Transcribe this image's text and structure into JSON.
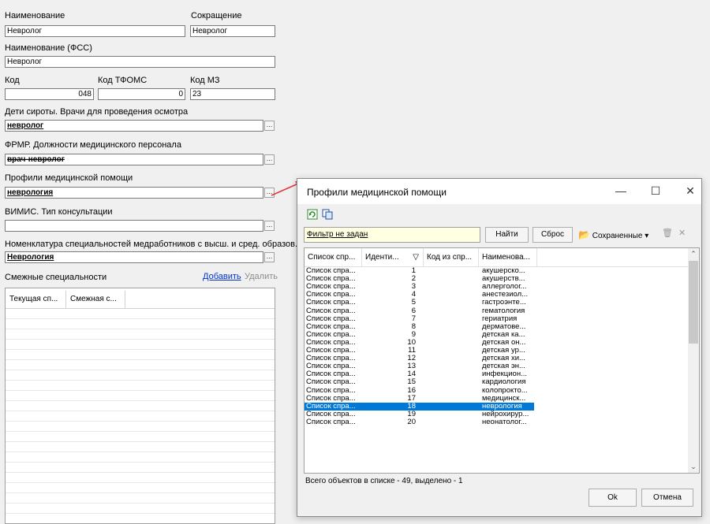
{
  "form": {
    "name_label": "Наименование",
    "name_value": "Невролог",
    "short_label": "Сокращение",
    "short_value": "Невролог",
    "fss_label": "Наименование (ФСС)",
    "fss_value": "Невролог",
    "code_label": "Код",
    "code_value": "048",
    "tfoms_label": "Код ТФОМС",
    "tfoms_value": "0",
    "mz_label": "Код МЗ",
    "mz_value": "23",
    "orphans_label": "Дети сироты. Врачи для проведения осмотра",
    "orphans_value": "невролог",
    "frmr_label": "ФРМР. Должности медицинского персонала",
    "frmr_value": "врач-невролог",
    "profiles_label": "Профили медицинской помощи",
    "profiles_value": "неврология",
    "vimis_label": "ВИМИС. Тип консультации",
    "vimis_value": "",
    "nomen_label": "Номенклатура специальностей медработников с высш. и сред. образов.",
    "nomen_value": "Неврология",
    "ellipsis": "...",
    "related_label": "Смежные специальности",
    "add_link": "Добавить",
    "delete_link": "Удалить",
    "grid_col1": "Текущая сп...",
    "grid_col2": "Смежная с..."
  },
  "dialog": {
    "title": "Профили медицинской помощи",
    "minimize": "—",
    "maximize": "☐",
    "close": "✕",
    "filter_text": "Фильтр не задан",
    "find_button": "Найти",
    "reset_button": "Сброс",
    "saved_button": "Сохраненные",
    "saved_caret": "▾",
    "columns": [
      "Список спр...",
      "Иденти...",
      "Код из спр...",
      "Наименова..."
    ],
    "sort_icon": "▽",
    "rows": [
      [
        "Список спра...",
        "1",
        "акушерско..."
      ],
      [
        "Список спра...",
        "2",
        "акушерств..."
      ],
      [
        "Список спра...",
        "3",
        "аллерголог..."
      ],
      [
        "Список спра...",
        "4",
        "анестезиол..."
      ],
      [
        "Список спра...",
        "5",
        "гастроэнте..."
      ],
      [
        "Список спра...",
        "6",
        "гематология"
      ],
      [
        "Список спра...",
        "7",
        "гериатрия"
      ],
      [
        "Список спра...",
        "8",
        "дерматове..."
      ],
      [
        "Список спра...",
        "9",
        "детская ка..."
      ],
      [
        "Список спра...",
        "10",
        "детская он..."
      ],
      [
        "Список спра...",
        "11",
        "детская ур..."
      ],
      [
        "Список спра...",
        "12",
        "детская хи..."
      ],
      [
        "Список спра...",
        "13",
        "детская эн..."
      ],
      [
        "Список спра...",
        "14",
        "инфекцион..."
      ],
      [
        "Список спра...",
        "15",
        "кардиология"
      ],
      [
        "Список спра...",
        "16",
        "колопрокто..."
      ],
      [
        "Список спра...",
        "17",
        "медицинск..."
      ],
      [
        "Список спра...",
        "18",
        "неврология"
      ],
      [
        "Список спра...",
        "19",
        "нейрохирур..."
      ],
      [
        "Список спра...",
        "20",
        "неонатолог..."
      ]
    ],
    "selected_index": 17,
    "status": "Всего объектов в списке - 49, выделено - 1",
    "ok_button": "Ok",
    "cancel_button": "Отмена"
  },
  "colors": {
    "selection": "#0078d7",
    "link": "#0033cc",
    "arrow": "#e03a3a"
  },
  "icons": [
    "refresh-icon",
    "copy-icon",
    "folder-icon",
    "clear-icon",
    "close-icon",
    "scroll-up-icon",
    "scroll-down-icon"
  ]
}
